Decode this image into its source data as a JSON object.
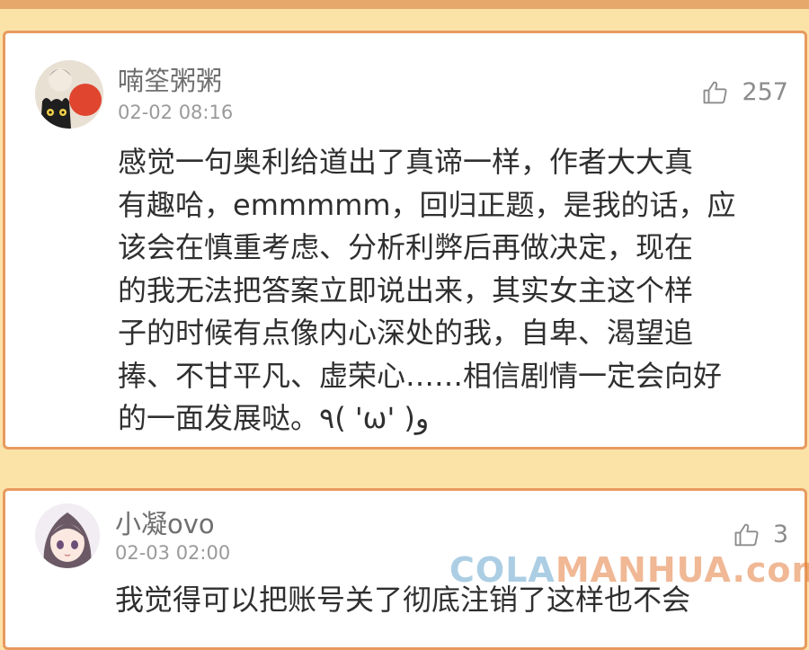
{
  "comments": [
    {
      "username": "喃筌粥粥",
      "time": "02-02 08:16",
      "likes": "257",
      "content": "感觉一句奥利给道出了真谛一样，作者大大真\n有趣哈，emmmmm，回归正题，是我的话，应\n该会在慎重考虑、分析利弊后再做决定，现在\n的我无法把答案立即说出来，其实女主这个样\n子的时候有点像内心深处的我，自卑、渴望追\n捧、不甘平凡、虚荣心……相信剧情一定会向好\n的一面发展哒。٩( 'ω' )و"
    },
    {
      "username": "小凝ovo",
      "time": "02-03 02:00",
      "likes": "3",
      "content": "我觉得可以把账号关了彻底注销了这样也不会"
    }
  ],
  "watermark": {
    "part1": "COLA",
    "part2": "MANHUA.com"
  },
  "colors": {
    "background": "#fbe3a8",
    "card_border": "#e89a5f",
    "band": "#e7a86b"
  }
}
